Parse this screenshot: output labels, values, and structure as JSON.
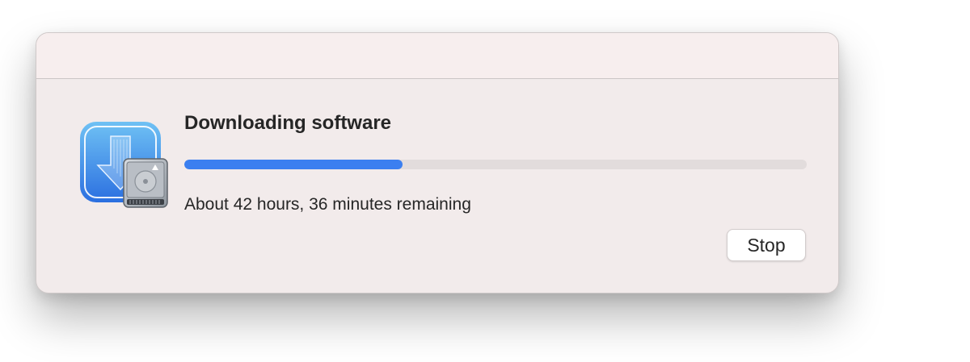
{
  "dialog": {
    "title": "Downloading software",
    "progress": 0.35,
    "status_text": "About 42 hours, 36 minutes remaining",
    "stop_label": "Stop",
    "icon": "software-update-download-icon"
  },
  "colors": {
    "progress_fill": "#3b7ff0",
    "progress_track": "#e2dcdc",
    "window_background": "#f2ebeb"
  }
}
